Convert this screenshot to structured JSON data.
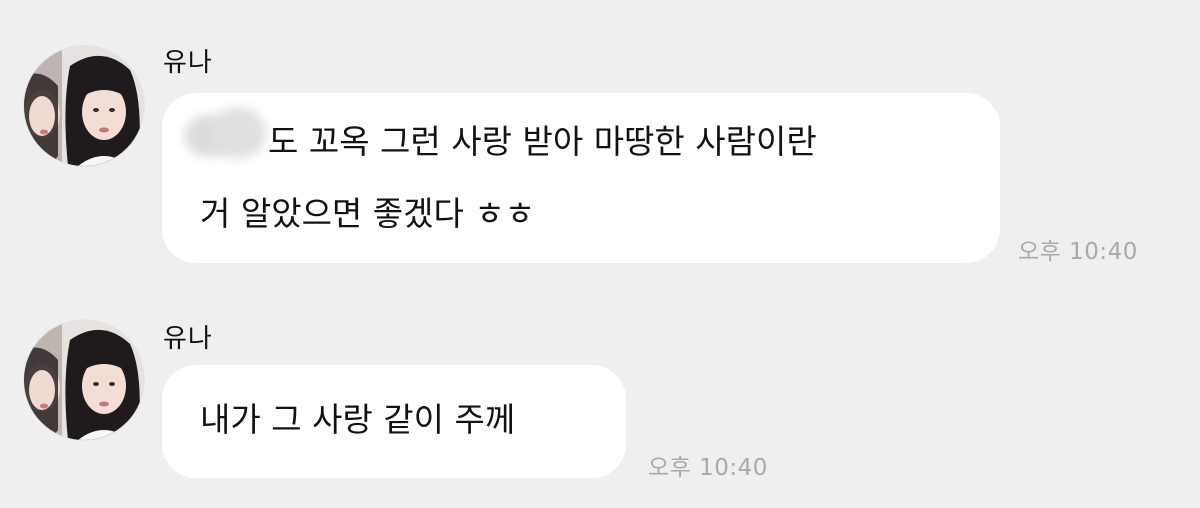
{
  "chat": {
    "messages": [
      {
        "sender": "유나",
        "avatar_icon": "profile-photo-avatar",
        "text_lines": [
          "도 꼬옥 그런 사랑 받아 마땅한 사람이란",
          "거 알았으면 좋겠다 ㅎㅎ"
        ],
        "has_redacted_name": true,
        "time": "오후 10:40"
      },
      {
        "sender": "유나",
        "avatar_icon": "profile-photo-avatar",
        "text_lines": [
          "내가 그 사랑 같이 주께"
        ],
        "has_redacted_name": false,
        "time": "오후 10:40"
      }
    ]
  },
  "colors": {
    "background": "#efefef",
    "bubble": "#ffffff",
    "timestamp": "#a9a9a9"
  }
}
